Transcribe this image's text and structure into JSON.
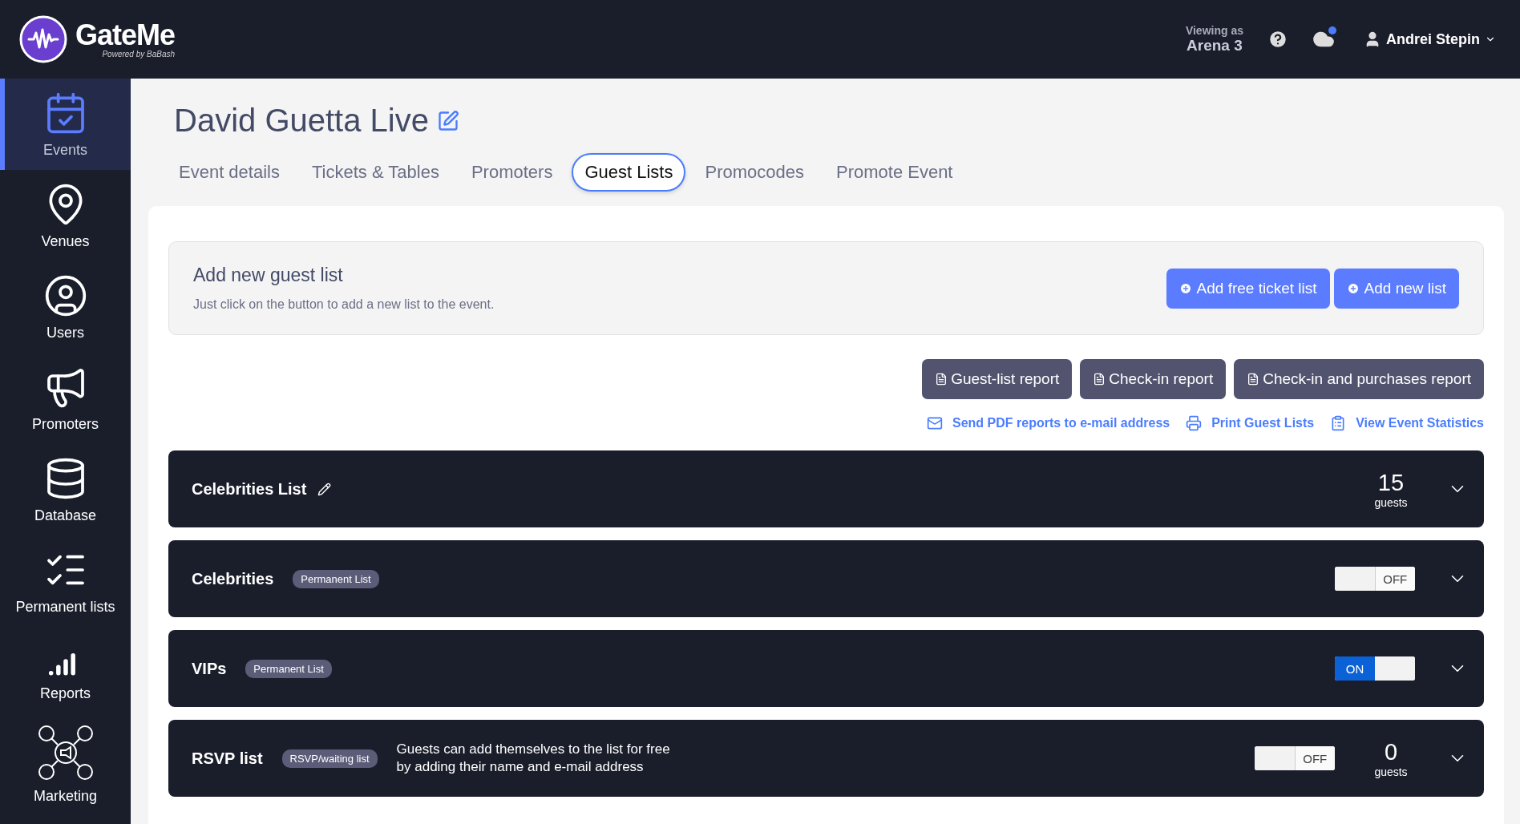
{
  "brand": {
    "name": "GateMe",
    "tagline": "Powered by BaBash"
  },
  "topbar": {
    "viewing_label": "Viewing as",
    "viewing_value": "Arena 3",
    "user": "Andrei Stepin",
    "notification": true
  },
  "sidebar": {
    "items": [
      {
        "label": "Events",
        "kind": "calendar",
        "selected": true
      },
      {
        "label": "Venues",
        "kind": "pin",
        "selected": false
      },
      {
        "label": "Users",
        "kind": "user",
        "selected": false
      },
      {
        "label": "Promoters",
        "kind": "megaphone",
        "selected": false
      },
      {
        "label": "Database",
        "kind": "database",
        "selected": false
      },
      {
        "label": "Permanent lists",
        "kind": "list",
        "selected": false
      },
      {
        "label": "Reports",
        "kind": "bars",
        "selected": false
      },
      {
        "label": "Marketing",
        "kind": "social",
        "selected": false
      }
    ]
  },
  "event": {
    "title": "David Guetta Live"
  },
  "tabs": [
    {
      "label": "Event details",
      "selected": false
    },
    {
      "label": "Tickets & Tables",
      "selected": false
    },
    {
      "label": "Promoters",
      "selected": false
    },
    {
      "label": "Guest Lists",
      "selected": true
    },
    {
      "label": "Promocodes",
      "selected": false
    },
    {
      "label": "Promote Event",
      "selected": false
    }
  ],
  "add_panel": {
    "title": "Add new guest list",
    "hint": "Just click on the button to add a new list to the event.",
    "buttons": [
      "Add free ticket list",
      "Add new list"
    ]
  },
  "report_buttons": [
    "Guest-list report",
    "Check-in report",
    "Check-in and purchases report"
  ],
  "links": [
    {
      "label": "Send PDF reports to e-mail address",
      "kind": "mail"
    },
    {
      "label": "Print Guest Lists",
      "kind": "print"
    },
    {
      "label": "View Event Statistics",
      "kind": "stats"
    }
  ],
  "lists": [
    {
      "name": "Celebrities List",
      "editable": true,
      "count": "15",
      "count_label": "guests"
    },
    {
      "name": "Celebrities",
      "editable": false,
      "badge": "Permanent List",
      "toggle": {
        "on": false,
        "label": "OFF"
      }
    },
    {
      "name": "VIPs",
      "editable": false,
      "badge": "Permanent List",
      "toggle": {
        "on": true,
        "label": "ON"
      }
    },
    {
      "name": "RSVP list",
      "editable": false,
      "badge": "RSVP/waiting list",
      "description": [
        "Guests can add themselves to the list for free",
        "by adding their name and e-mail address"
      ],
      "toggle": {
        "on": false,
        "label": "OFF"
      },
      "count": "0",
      "count_label": "guests"
    }
  ]
}
